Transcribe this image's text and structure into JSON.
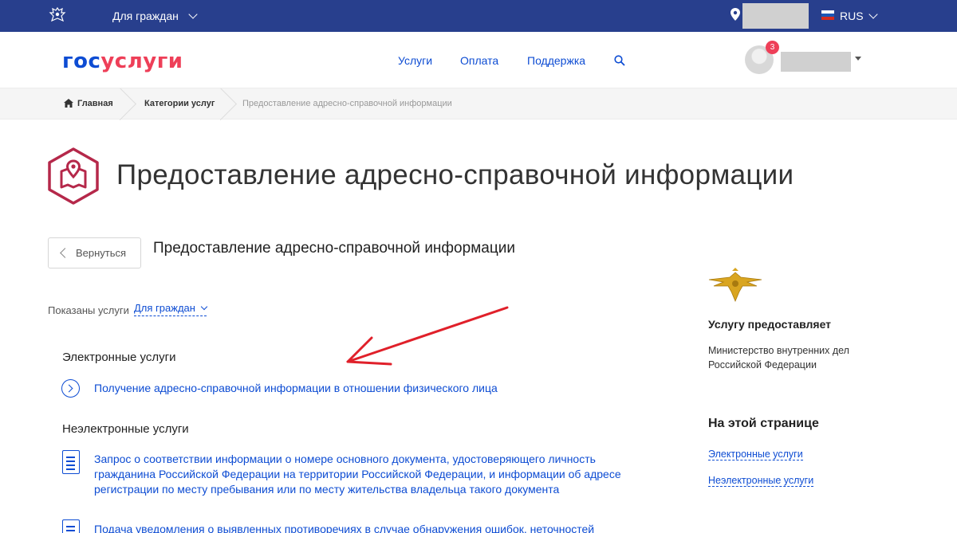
{
  "topbar": {
    "citizens_label": "Для граждан",
    "language": "RUS",
    "bg_color": "#283f8d"
  },
  "header": {
    "logo_part1": "гос",
    "logo_part2": "услуги",
    "nav": [
      "Услуги",
      "Оплата",
      "Поддержка"
    ],
    "notifications_count": "3"
  },
  "breadcrumb": {
    "home": "Главная",
    "category": "Категории услуг",
    "current": "Предоставление адресно-справочной информации"
  },
  "page": {
    "title": "Предоставление адресно-справочной информации",
    "back_label": "Вернуться",
    "subtitle": "Предоставление адресно-справочной информации",
    "shown_label": "Показаны услуги",
    "shown_filter": "Для граждан"
  },
  "sections": {
    "electronic": {
      "title": "Электронные услуги",
      "items": [
        "Получение адресно-справочной информации в отношении физического лица"
      ]
    },
    "non_electronic": {
      "title": "Неэлектронные услуги",
      "items": [
        "Запрос о соответствии информации о номере основного документа, удостоверяющего личность гражданина Российской Федерации на территории Российской Федерации, и информации об адресе регистрации по месту пребывания или по месту жительства владельца такого документа",
        "Подача уведомления о выявленных противоречиях в случае обнаружения ошибок, неточностей"
      ]
    }
  },
  "sidebar": {
    "provider_heading": "Услугу предоставляет",
    "provider_name": "Министерство внутренних дел Российской Федерации",
    "on_page_heading": "На этой странице",
    "on_page_links": [
      "Электронные услуги",
      "Неэлектронные услуги"
    ]
  },
  "colors": {
    "accent": "#0d4cd3",
    "brand_red": "#ee3f58",
    "icon_red": "#b5284a"
  }
}
